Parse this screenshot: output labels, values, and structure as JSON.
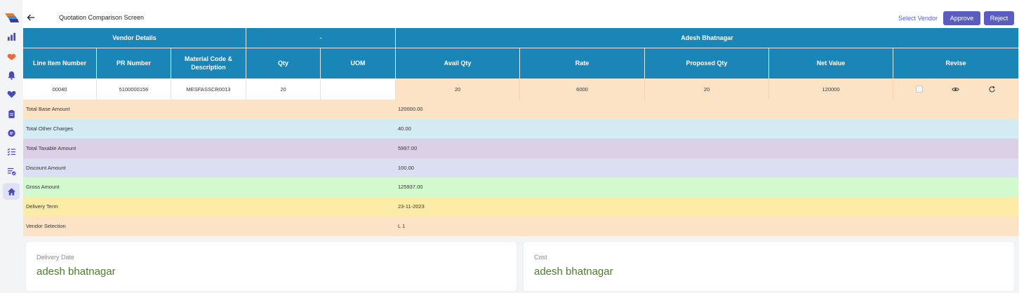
{
  "header": {
    "title": "Quotation Comparison Screen",
    "select_vendor": "Select Vendor",
    "approve": "Approve",
    "reject": "Reject"
  },
  "sidebar": {
    "items": [
      "logo",
      "bar-chart-icon",
      "handshake-icon",
      "bell-icon",
      "heart-icon",
      "clipboard-icon",
      "bag-icon",
      "checklist-icon",
      "list-check-icon",
      "home-icon"
    ],
    "active": "home-icon"
  },
  "table": {
    "groups": {
      "vendor_details": "Vendor Details",
      "dash": "-",
      "vendor_name": "Adesh Bhatnagar"
    },
    "columns": [
      "Line Item Number",
      "PR Number",
      "Material Code & Description",
      "Qty",
      "UOM",
      "Avail Qty",
      "Rate",
      "Proposed Qty",
      "Net Value",
      "Revise"
    ],
    "row": {
      "line_item": "00040",
      "pr_number": "5100000156",
      "material_code": "MESFASSCR0013",
      "qty": "20",
      "uom": "",
      "avail_qty": "20",
      "rate": "6000",
      "proposed_qty": "20",
      "net_value": "120000"
    },
    "summary": [
      {
        "label": "Total Base Amount",
        "value": "120000.00",
        "color": "#fde3c6"
      },
      {
        "label": "Total Other Charges",
        "value": "40.00",
        "color": "#d3ebf3"
      },
      {
        "label": "Total Taxable Amount",
        "value": "5997.00",
        "color": "#dcd0e6"
      },
      {
        "label": "Discount Amount",
        "value": "100.00",
        "color": "#dcdff1"
      },
      {
        "label": "Gross Amount",
        "value": "125937.00",
        "color": "#d3f9cf"
      },
      {
        "label": "Delivery Term",
        "value": "23-11-2023",
        "color": "#fdeca8"
      },
      {
        "label": "Vendor Selection",
        "value": "L 1",
        "color": "#fde3c6"
      }
    ]
  },
  "cards": [
    {
      "label": "Delivery Date",
      "value": "adesh bhatnagar"
    },
    {
      "label": "Cost",
      "value": "adesh bhatnagar"
    }
  ],
  "colors": {
    "header_bg": "#1a86b8",
    "button_bg": "#5b5cbf",
    "link": "#4f5fd9",
    "card_value": "#4d7c2a",
    "sidebar_icon": "#4a49b8"
  }
}
